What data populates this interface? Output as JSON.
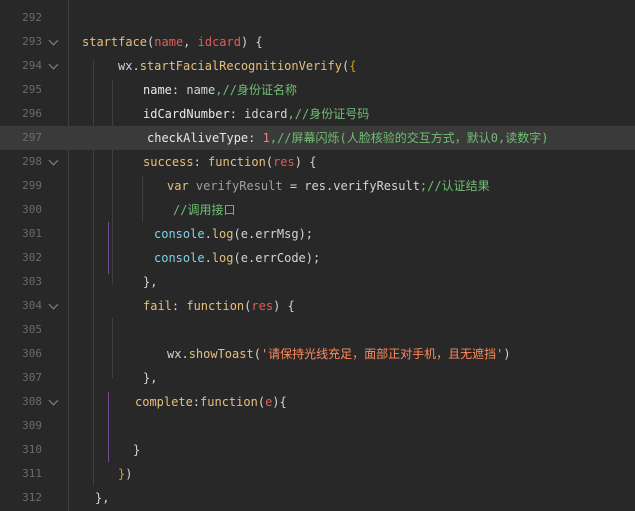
{
  "lines": [
    {
      "num": "292",
      "fold": false,
      "tokens": []
    },
    {
      "num": "293",
      "fold": true,
      "tokens": [
        {
          "t": "startface",
          "c": "t-fn"
        },
        {
          "t": "(",
          "c": "t-plain"
        },
        {
          "t": "name",
          "c": "t-param"
        },
        {
          "t": ", ",
          "c": "t-plain"
        },
        {
          "t": "idcard",
          "c": "t-param"
        },
        {
          "t": ") {",
          "c": "t-plain"
        }
      ]
    },
    {
      "num": "294",
      "fold": true,
      "tokens": [
        {
          "t": "wx",
          "c": "t-plain"
        },
        {
          "t": ".",
          "c": "t-plain"
        },
        {
          "t": "startFacialRecognitionVerify",
          "c": "t-fn"
        },
        {
          "t": "(",
          "c": "t-plain"
        },
        {
          "t": "{",
          "c": "t-bracket"
        }
      ]
    },
    {
      "num": "295",
      "fold": false,
      "tokens": [
        {
          "t": "name",
          "c": "t-prop"
        },
        {
          "t": ": ",
          "c": "t-plain"
        },
        {
          "t": "name",
          "c": "t-plain"
        },
        {
          "t": ",//身份证名称",
          "c": "t-com"
        }
      ]
    },
    {
      "num": "296",
      "fold": false,
      "tokens": [
        {
          "t": "idCardNumber",
          "c": "t-prop"
        },
        {
          "t": ": ",
          "c": "t-plain"
        },
        {
          "t": "idcard",
          "c": "t-plain"
        },
        {
          "t": ",//身份证号码",
          "c": "t-com"
        }
      ]
    },
    {
      "num": "297",
      "fold": false,
      "tokens": [
        {
          "t": "checkAliveType",
          "c": "t-prop"
        },
        {
          "t": ": ",
          "c": "t-plain"
        },
        {
          "t": "1",
          "c": "t-num"
        },
        {
          "t": ",//屏幕闪烁(人脸核验的交互方式，默认0,读数字)",
          "c": "t-com"
        }
      ]
    },
    {
      "num": "298",
      "fold": true,
      "tokens": [
        {
          "t": "success",
          "c": "t-fn"
        },
        {
          "t": ": ",
          "c": "t-plain"
        },
        {
          "t": "function",
          "c": "t-fn"
        },
        {
          "t": "(",
          "c": "t-plain"
        },
        {
          "t": "res",
          "c": "t-param"
        },
        {
          "t": ") {",
          "c": "t-plain"
        }
      ]
    },
    {
      "num": "299",
      "fold": false,
      "tokens": [
        {
          "t": "var ",
          "c": "t-fn"
        },
        {
          "t": "verifyResult",
          "c": "t-dim"
        },
        {
          "t": " = ",
          "c": "t-plain"
        },
        {
          "t": "res",
          "c": "t-plain"
        },
        {
          "t": ".",
          "c": "t-plain"
        },
        {
          "t": "verifyResult",
          "c": "t-plain"
        },
        {
          "t": ";//认证结果",
          "c": "t-com"
        }
      ]
    },
    {
      "num": "300",
      "fold": false,
      "tokens": [
        {
          "t": "//调用接口",
          "c": "t-com"
        }
      ]
    },
    {
      "num": "301",
      "fold": false,
      "tokens": [
        {
          "t": "console",
          "c": "t-obj"
        },
        {
          "t": ".",
          "c": "t-plain"
        },
        {
          "t": "log",
          "c": "t-fn"
        },
        {
          "t": "(",
          "c": "t-plain"
        },
        {
          "t": "e",
          "c": "t-plain"
        },
        {
          "t": ".",
          "c": "t-plain"
        },
        {
          "t": "errMsg",
          "c": "t-plain"
        },
        {
          "t": ");",
          "c": "t-plain"
        }
      ]
    },
    {
      "num": "302",
      "fold": false,
      "tokens": [
        {
          "t": "console",
          "c": "t-obj"
        },
        {
          "t": ".",
          "c": "t-plain"
        },
        {
          "t": "log",
          "c": "t-fn"
        },
        {
          "t": "(",
          "c": "t-plain"
        },
        {
          "t": "e",
          "c": "t-plain"
        },
        {
          "t": ".",
          "c": "t-plain"
        },
        {
          "t": "errCode",
          "c": "t-plain"
        },
        {
          "t": ");",
          "c": "t-plain"
        }
      ]
    },
    {
      "num": "303",
      "fold": false,
      "tokens": [
        {
          "t": "},",
          "c": "t-plain"
        }
      ]
    },
    {
      "num": "304",
      "fold": true,
      "tokens": [
        {
          "t": "fail",
          "c": "t-fn"
        },
        {
          "t": ": ",
          "c": "t-plain"
        },
        {
          "t": "function",
          "c": "t-fn"
        },
        {
          "t": "(",
          "c": "t-plain"
        },
        {
          "t": "res",
          "c": "t-param"
        },
        {
          "t": ") {",
          "c": "t-plain"
        }
      ]
    },
    {
      "num": "305",
      "fold": false,
      "tokens": []
    },
    {
      "num": "306",
      "fold": false,
      "tokens": [
        {
          "t": "wx",
          "c": "t-plain"
        },
        {
          "t": ".",
          "c": "t-plain"
        },
        {
          "t": "showToast",
          "c": "t-fn"
        },
        {
          "t": "(",
          "c": "t-plain"
        },
        {
          "t": "'请保持光线充足，面部正对手机，且无遮挡'",
          "c": "t-str"
        },
        {
          "t": ")",
          "c": "t-plain"
        }
      ]
    },
    {
      "num": "307",
      "fold": false,
      "tokens": [
        {
          "t": "},",
          "c": "t-plain"
        }
      ]
    },
    {
      "num": "308",
      "fold": true,
      "tokens": [
        {
          "t": "complete",
          "c": "t-fn"
        },
        {
          "t": ":",
          "c": "t-plain"
        },
        {
          "t": "function",
          "c": "t-fn"
        },
        {
          "t": "(",
          "c": "t-plain"
        },
        {
          "t": "e",
          "c": "t-param"
        },
        {
          "t": "){",
          "c": "t-plain"
        }
      ]
    },
    {
      "num": "309",
      "fold": false,
      "tokens": []
    },
    {
      "num": "310",
      "fold": false,
      "tokens": [
        {
          "t": "}",
          "c": "t-plain"
        }
      ]
    },
    {
      "num": "311",
      "fold": false,
      "tokens": [
        {
          "t": "}",
          "c": "t-bracket"
        },
        {
          "t": ")",
          "c": "t-plain"
        }
      ]
    },
    {
      "num": "312",
      "fold": false,
      "tokens": [
        {
          "t": "},",
          "c": "t-plain"
        }
      ]
    }
  ],
  "top_partial": "},"
}
